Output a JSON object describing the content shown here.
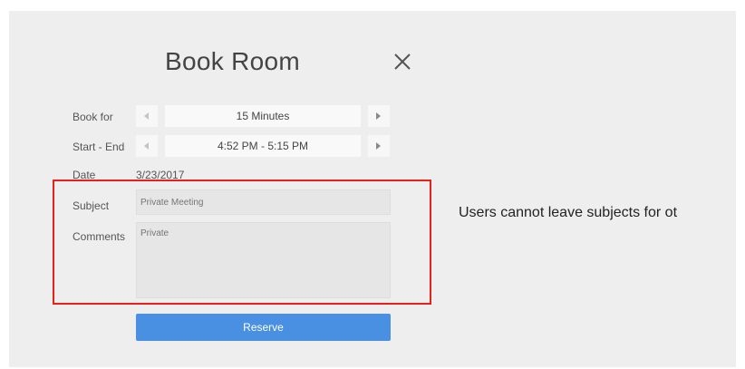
{
  "dialog": {
    "title": "Book Room",
    "close_icon": "close-icon"
  },
  "book_for": {
    "label": "Book for",
    "value": "15 Minutes",
    "prev_icon": "chevron-left-icon",
    "next_icon": "chevron-right-icon"
  },
  "start_end": {
    "label": "Start - End",
    "value": "4:52 PM - 5:15 PM",
    "prev_icon": "chevron-left-icon",
    "next_icon": "chevron-right-icon"
  },
  "date": {
    "label": "Date",
    "value": "3/23/2017"
  },
  "subject": {
    "label": "Subject",
    "placeholder": "Private Meeting"
  },
  "comments": {
    "label": "Comments",
    "placeholder": "Private"
  },
  "reserve": {
    "label": "Reserve"
  },
  "annotation": {
    "text": "Users cannot leave subjects for ot",
    "highlight_color": "#e8201c"
  },
  "colors": {
    "panel_bg": "#eeeeee",
    "accent": "#4a90e2"
  }
}
